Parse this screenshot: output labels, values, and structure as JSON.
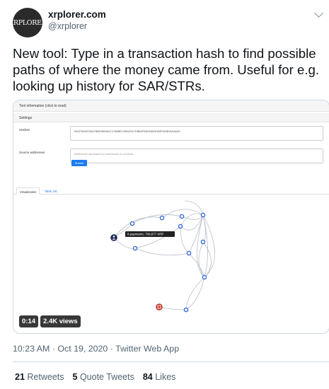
{
  "author": {
    "avatar_text": "XRPLORER",
    "name": "xrplorer.com",
    "handle": "@xrplorer"
  },
  "tweet": {
    "text": "New tool: Type in a transaction hash to find possible paths of where the money came from. Useful for e.g. looking up history for SAR/STRs."
  },
  "media": {
    "tool_info_label": "Tool information (click to read)",
    "settings_label": "Settings",
    "hashes_label": "Hashes",
    "hashes_value": "6A1F5D0E03ACB6E3BD8AC1758BEC66A2047D8B4F8ADB6030E8F0D8D6A46A5",
    "source_label": "Source addresses",
    "source_placeholder": "Addresses separated by linebreaks or commas",
    "submit_label": "Submit",
    "tabs": [
      "Visualization",
      "Table, list"
    ],
    "tooltip": "8 payments: 700,677 XRP",
    "video_time": "0:14",
    "video_views": "2.4K views"
  },
  "meta": {
    "timestamp": "10:23 AM · Oct 19, 2020 · Twitter Web App"
  },
  "stats": {
    "retweets_count": "21",
    "retweets_label": "Retweets",
    "quotes_count": "5",
    "quotes_label": "Quote Tweets",
    "likes_count": "84",
    "likes_label": "Likes"
  },
  "colors": {
    "node_blue": "#3b6fd6",
    "start_node": "#1f2a5a",
    "end_node": "#c0392b",
    "edge": "#b8bec7"
  }
}
